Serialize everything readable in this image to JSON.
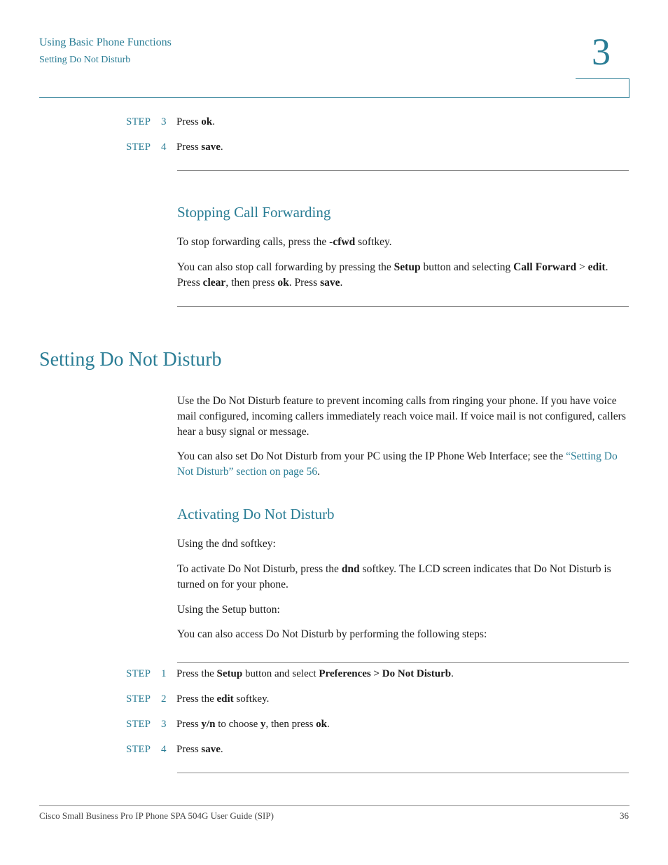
{
  "header": {
    "chapter_title": "Using Basic Phone Functions",
    "section_title": "Setting Do Not Disturb",
    "chapter_number": "3"
  },
  "top_steps": [
    {
      "label": "STEP",
      "number": "3",
      "parts": [
        "Press ",
        "ok",
        "."
      ]
    },
    {
      "label": "STEP",
      "number": "4",
      "parts": [
        "Press ",
        "save",
        "."
      ]
    }
  ],
  "stopping": {
    "heading": "Stopping Call Forwarding",
    "p1": [
      "To stop forwarding calls, press the -",
      "cfwd",
      " softkey."
    ],
    "p2": [
      "You can also stop call forwarding by pressing the ",
      "Setup",
      " button and selecting ",
      "Call Forward",
      " > ",
      "edit",
      ". Press ",
      "clear",
      ", then press ",
      "ok",
      ". Press ",
      "save",
      "."
    ]
  },
  "dnd": {
    "heading": "Setting Do Not Disturb",
    "p1": "Use the Do Not Disturb feature to prevent incoming calls from ringing your phone. If you have voice mail configured, incoming callers immediately reach voice mail. If voice mail is not configured, callers hear a busy signal or message.",
    "p2_text": "You can also set Do Not Disturb from your PC using the IP Phone Web Interface; see the ",
    "p2_link": "“Setting Do Not Disturb” section on page 56",
    "p2_end": "."
  },
  "activating": {
    "heading": "Activating Do Not Disturb",
    "p1": "Using the dnd softkey:",
    "p2": [
      "To activate Do Not Disturb, press the ",
      "dnd",
      " softkey. The LCD screen indicates that Do Not Disturb is turned on for your phone."
    ],
    "p3": "Using the Setup button:",
    "p4": "You can also access Do Not Disturb by performing the following steps:"
  },
  "bottom_steps": [
    {
      "label": "STEP",
      "number": "1",
      "parts": [
        "Press the ",
        "Setup",
        " button and select ",
        "Preferences > Do Not Disturb",
        "."
      ]
    },
    {
      "label": "STEP",
      "number": "2",
      "parts": [
        "Press the ",
        "edit",
        " softkey."
      ]
    },
    {
      "label": "STEP",
      "number": "3",
      "parts": [
        "Press ",
        "y/n",
        " to choose ",
        "y",
        ", then press ",
        "ok",
        "."
      ]
    },
    {
      "label": "STEP",
      "number": "4",
      "parts": [
        "Press ",
        "save",
        "."
      ]
    }
  ],
  "footer": {
    "title": "Cisco Small Business Pro IP Phone SPA 504G User Guide (SIP)",
    "page": "36"
  },
  "colors": {
    "accent": "#2a7d95",
    "text": "#1a1a1a",
    "rule": "#888888"
  }
}
